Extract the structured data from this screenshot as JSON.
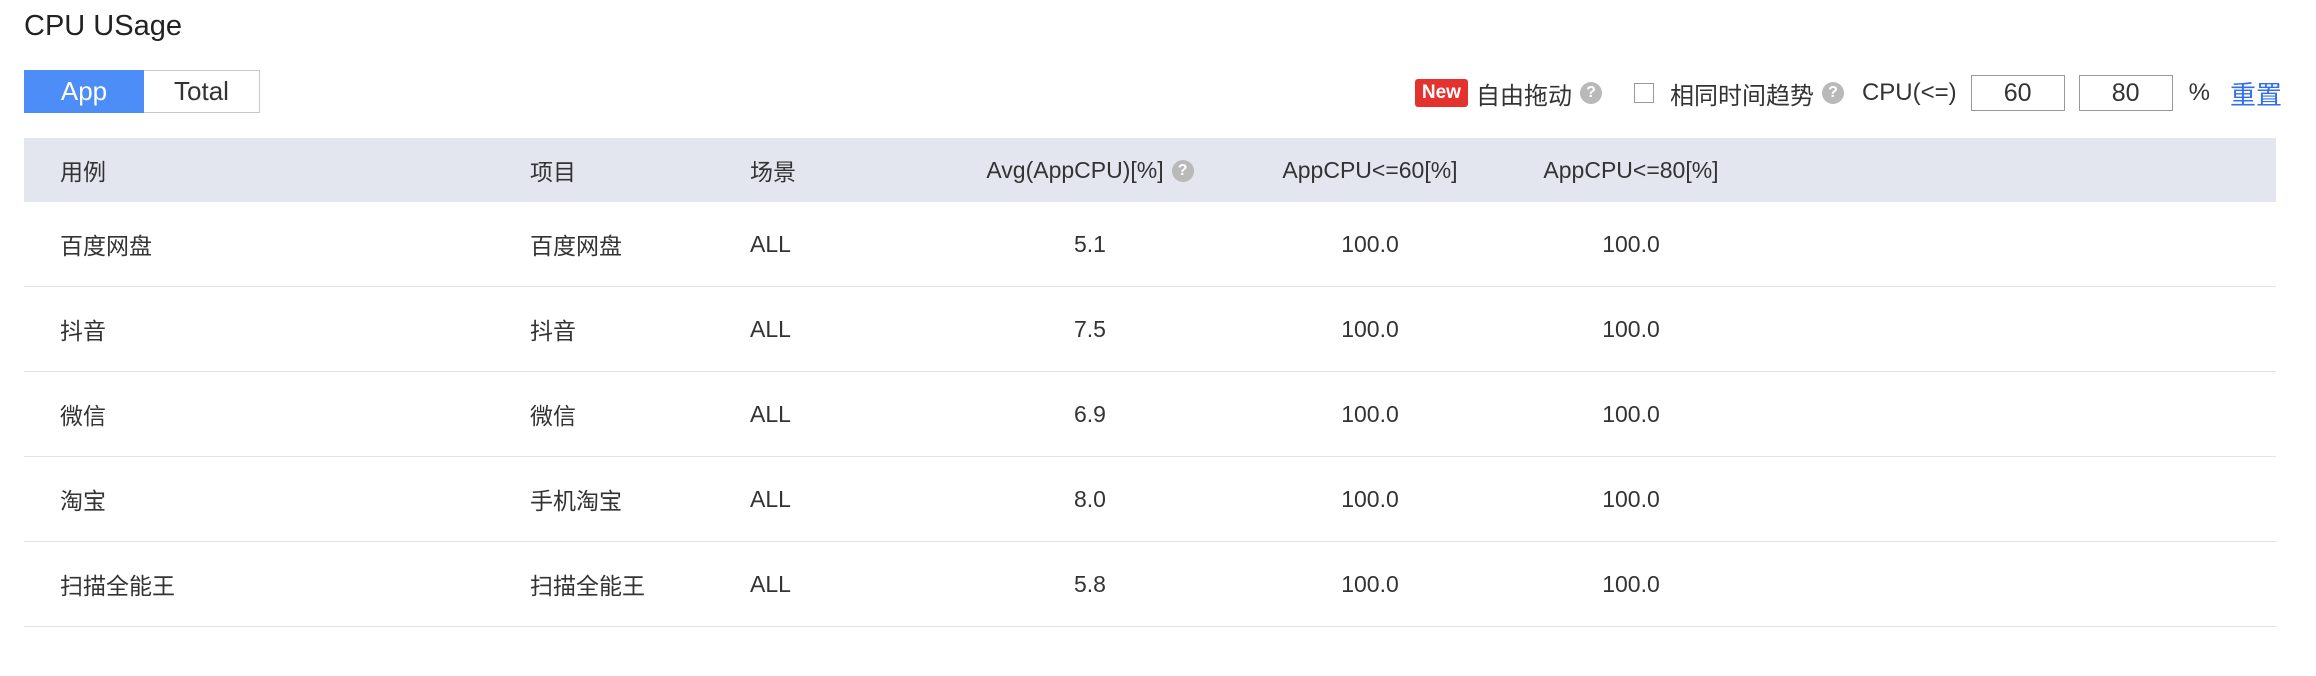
{
  "title": "CPU USage",
  "tabs": {
    "app": "App",
    "total": "Total"
  },
  "toolbar": {
    "new_badge": "New",
    "drag_label": "自由拖动",
    "help_glyph": "?",
    "same_trend_label": "相同时间趋势",
    "cpu_label": "CPU(<=)",
    "threshold1": "60",
    "threshold2": "80",
    "percent": "%",
    "reset": "重置",
    "same_trend_checked": false
  },
  "table": {
    "headers": {
      "case": "用例",
      "project": "项目",
      "scene": "场景",
      "avg": "Avg(AppCPU)[%]",
      "le60": "AppCPU<=60[%]",
      "le80": "AppCPU<=80[%]"
    },
    "rows": [
      {
        "case": "百度网盘",
        "project": "百度网盘",
        "scene": "ALL",
        "avg": "5.1",
        "le60": "100.0",
        "le80": "100.0"
      },
      {
        "case": "抖音",
        "project": "抖音",
        "scene": "ALL",
        "avg": "7.5",
        "le60": "100.0",
        "le80": "100.0"
      },
      {
        "case": "微信",
        "project": "微信",
        "scene": "ALL",
        "avg": "6.9",
        "le60": "100.0",
        "le80": "100.0"
      },
      {
        "case": "淘宝",
        "project": "手机淘宝",
        "scene": "ALL",
        "avg": "8.0",
        "le60": "100.0",
        "le80": "100.0"
      },
      {
        "case": "扫描全能王",
        "project": "扫描全能王",
        "scene": "ALL",
        "avg": "5.8",
        "le60": "100.0",
        "le80": "100.0"
      }
    ]
  },
  "colors": {
    "accent": "#4d8df7",
    "badge": "#e4322e",
    "link": "#2f6ff0",
    "header_bg": "#e3e6ef"
  }
}
